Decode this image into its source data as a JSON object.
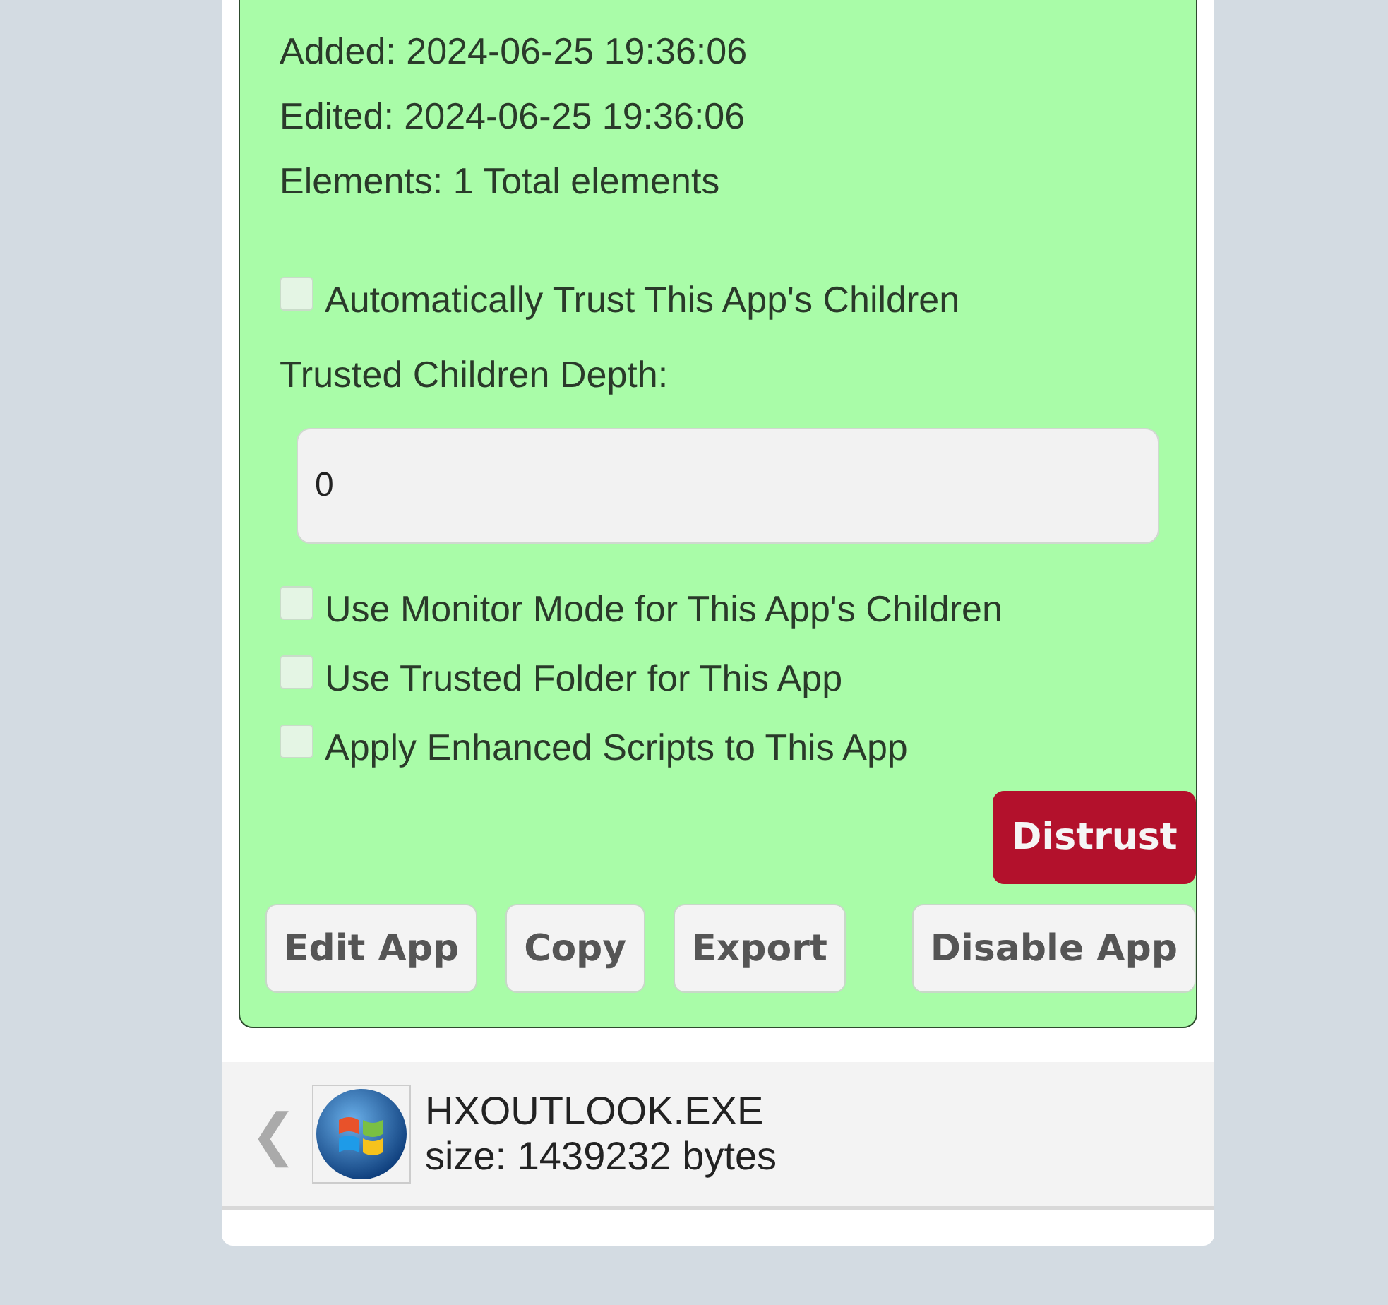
{
  "details": [
    "Added: 2024-06-25 19:36:06",
    "Edited: 2024-06-25 19:36:06",
    "Elements: 1 Total elements"
  ],
  "auto_trust": {
    "label": "Automatically Trust This App's Children",
    "checked": false
  },
  "depth": {
    "label": "Trusted Children Depth:",
    "value": "0"
  },
  "options": [
    {
      "label": "Use Monitor Mode for This App's Children",
      "checked": false
    },
    {
      "label": "Use Trusted Folder for This App",
      "checked": false
    },
    {
      "label": "Apply Enhanced Scripts to This App",
      "checked": false
    }
  ],
  "distrust_button": "Distrust",
  "buttons": [
    "Edit App",
    "Copy",
    "Export",
    "Disable App"
  ],
  "next_app": {
    "arrow": "❮",
    "name": "HXOUTLOOK.EXE",
    "size": "size: 1439232 bytes"
  }
}
